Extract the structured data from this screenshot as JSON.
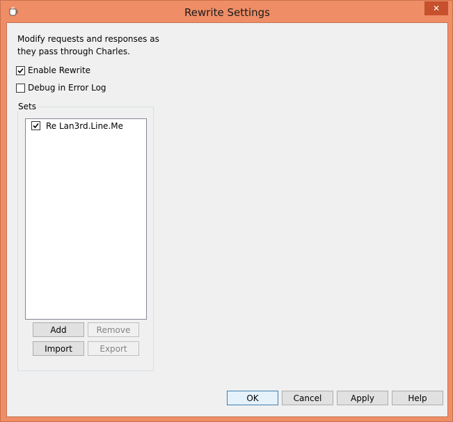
{
  "window": {
    "title": "Rewrite Settings",
    "close_symbol": "✕",
    "app_icon": "charles-pot-icon"
  },
  "description": "Modify requests and responses as\nthey pass through Charles.",
  "options": {
    "enable_rewrite": {
      "label": "Enable Rewrite",
      "checked": true
    },
    "debug_error_log": {
      "label": "Debug in Error Log",
      "checked": false
    }
  },
  "sets": {
    "label": "Sets",
    "items": [
      {
        "label": "Re Lan3rd.Line.Me",
        "checked": true
      }
    ],
    "buttons": {
      "add": "Add",
      "remove": "Remove",
      "import": "Import",
      "export": "Export"
    }
  },
  "footer": {
    "ok": "OK",
    "cancel": "Cancel",
    "apply": "Apply",
    "help": "Help"
  },
  "colors": {
    "title_bar": "#EE8D66",
    "close_button": "#C7502D",
    "dialog_bg": "#F0F0F0"
  }
}
